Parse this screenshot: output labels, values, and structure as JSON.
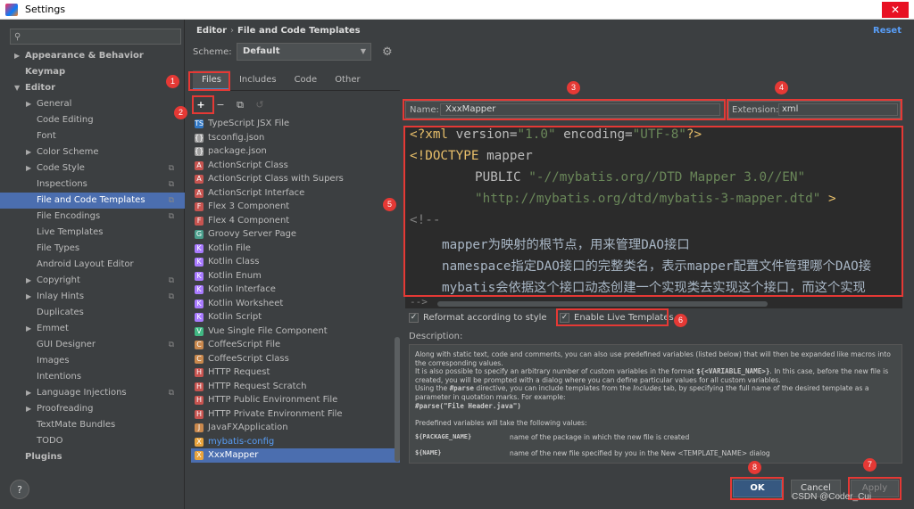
{
  "window": {
    "title": "Settings",
    "close_symbol": "✕"
  },
  "sidebar": {
    "search_placeholder": "",
    "items": [
      {
        "label": "Appearance & Behavior",
        "level": 0,
        "arrow": "▶",
        "bold": true
      },
      {
        "label": "Keymap",
        "level": 0,
        "arrow": "",
        "bold": true
      },
      {
        "label": "Editor",
        "level": 0,
        "arrow": "▼",
        "bold": true
      },
      {
        "label": "General",
        "level": 1,
        "arrow": "▶"
      },
      {
        "label": "Code Editing",
        "level": 1,
        "arrow": ""
      },
      {
        "label": "Font",
        "level": 1,
        "arrow": ""
      },
      {
        "label": "Color Scheme",
        "level": 1,
        "arrow": "▶"
      },
      {
        "label": "Code Style",
        "level": 1,
        "arrow": "▶",
        "copy": true
      },
      {
        "label": "Inspections",
        "level": 1,
        "arrow": "",
        "copy": true
      },
      {
        "label": "File and Code Templates",
        "level": 1,
        "arrow": "",
        "copy": true,
        "selected": true
      },
      {
        "label": "File Encodings",
        "level": 1,
        "arrow": "",
        "copy": true
      },
      {
        "label": "Live Templates",
        "level": 1,
        "arrow": ""
      },
      {
        "label": "File Types",
        "level": 1,
        "arrow": ""
      },
      {
        "label": "Android Layout Editor",
        "level": 1,
        "arrow": ""
      },
      {
        "label": "Copyright",
        "level": 1,
        "arrow": "▶",
        "copy": true
      },
      {
        "label": "Inlay Hints",
        "level": 1,
        "arrow": "▶",
        "copy": true
      },
      {
        "label": "Duplicates",
        "level": 1,
        "arrow": ""
      },
      {
        "label": "Emmet",
        "level": 1,
        "arrow": "▶"
      },
      {
        "label": "GUI Designer",
        "level": 1,
        "arrow": "",
        "copy": true
      },
      {
        "label": "Images",
        "level": 1,
        "arrow": ""
      },
      {
        "label": "Intentions",
        "level": 1,
        "arrow": ""
      },
      {
        "label": "Language Injections",
        "level": 1,
        "arrow": "▶",
        "copy": true
      },
      {
        "label": "Proofreading",
        "level": 1,
        "arrow": "▶"
      },
      {
        "label": "TextMate Bundles",
        "level": 1,
        "arrow": ""
      },
      {
        "label": "TODO",
        "level": 1,
        "arrow": ""
      },
      {
        "label": "Plugins",
        "level": 0,
        "arrow": "",
        "bold": true
      }
    ]
  },
  "header": {
    "crumb_1": "Editor",
    "crumb_sep": "›",
    "crumb_2": "File and Code Templates",
    "reset": "Reset",
    "scheme_label": "Scheme:",
    "scheme_value": "Default"
  },
  "tabs": [
    "Files",
    "Includes",
    "Code",
    "Other"
  ],
  "toolbar": {
    "add": "+",
    "remove": "−",
    "copy": "⧉",
    "reset": "↺"
  },
  "files": [
    {
      "name": "TypeScript JSX File",
      "icon": "TS",
      "color": "#3178c6"
    },
    {
      "name": "tsconfig.json",
      "icon": "{}",
      "color": "#a0a0a0"
    },
    {
      "name": "package.json",
      "icon": "{}",
      "color": "#a0a0a0"
    },
    {
      "name": "ActionScript Class",
      "icon": "A",
      "color": "#c75450"
    },
    {
      "name": "ActionScript Class with Supers",
      "icon": "A",
      "color": "#c75450"
    },
    {
      "name": "ActionScript Interface",
      "icon": "A",
      "color": "#c75450"
    },
    {
      "name": "Flex 3 Component",
      "icon": "F",
      "color": "#c75450"
    },
    {
      "name": "Flex 4 Component",
      "icon": "F",
      "color": "#c75450"
    },
    {
      "name": "Groovy Server Page",
      "icon": "G",
      "color": "#4a9e8c"
    },
    {
      "name": "Kotlin File",
      "icon": "K",
      "color": "#a97bff"
    },
    {
      "name": "Kotlin Class",
      "icon": "K",
      "color": "#a97bff"
    },
    {
      "name": "Kotlin Enum",
      "icon": "K",
      "color": "#a97bff"
    },
    {
      "name": "Kotlin Interface",
      "icon": "K",
      "color": "#a97bff"
    },
    {
      "name": "Kotlin Worksheet",
      "icon": "K",
      "color": "#a97bff"
    },
    {
      "name": "Kotlin Script",
      "icon": "K",
      "color": "#a97bff"
    },
    {
      "name": "Vue Single File Component",
      "icon": "V",
      "color": "#41b883"
    },
    {
      "name": "CoffeeScript File",
      "icon": "C",
      "color": "#c9884c"
    },
    {
      "name": "CoffeeScript Class",
      "icon": "C",
      "color": "#c9884c"
    },
    {
      "name": "HTTP Request",
      "icon": "H",
      "color": "#c75450"
    },
    {
      "name": "HTTP Request Scratch",
      "icon": "H",
      "color": "#c75450"
    },
    {
      "name": "HTTP Public Environment File",
      "icon": "H",
      "color": "#c75450"
    },
    {
      "name": "HTTP Private Environment File",
      "icon": "H",
      "color": "#c75450"
    },
    {
      "name": "JavaFXApplication",
      "icon": "J",
      "color": "#c9884c"
    },
    {
      "name": "mybatis-config",
      "icon": "X",
      "color": "#e8a33d",
      "blue": true
    },
    {
      "name": "XxxMapper",
      "icon": "X",
      "color": "#e8a33d",
      "selected": true
    }
  ],
  "name_field": {
    "label": "Name:",
    "value": "XxxMapper"
  },
  "extension_field": {
    "label": "Extension:",
    "value": "xml"
  },
  "editor": {
    "line1_open": "<?xml ",
    "line1_attr1": "version",
    "line1_eq1": "=",
    "line1_val1": "\"1.0\"",
    "line1_attr2": " encoding",
    "line1_eq2": "=",
    "line1_val2": "\"UTF-8\"",
    "line1_close": "?>",
    "line2_open": "<!DOCTYPE ",
    "line2_rest": "mapper",
    "line3_kw": "PUBLIC ",
    "line3_str": "\"-//mybatis.org//DTD Mapper 3.0//EN\"",
    "line4_str": "\"http://mybatis.org/dtd/mybatis-3-mapper.dtd\"",
    "line4_close": " >",
    "line5": "<!--",
    "line6": "mapper为映射的根节点，用来管理DAO接口",
    "line7": "namespace指定DAO接口的完整类名，表示mapper配置文件管理哪个DAO接",
    "line8": "mybatis会依据这个接口动态创建一个实现类去实现这个接口，而这个实现",
    "line9": "-->"
  },
  "options": {
    "reformat": "Reformat according to style",
    "live_templates": "Enable Live Templates",
    "check": "✓"
  },
  "description": {
    "label": "Description:",
    "p1": "Along with static text, code and comments, you can also use predefined variables (listed below) that will then be expanded like macros into the corresponding values.",
    "p2a": "It is also possible to specify an arbitrary number of custom variables in the format ",
    "p2code": "${<VARIABLE_NAME>}",
    "p2b": ". In this case, before the new file is created, you will be prompted with a dialog where you can define particular values for all custom variables.",
    "p3a": "Using the ",
    "p3code": "#parse",
    "p3b": " directive, you can include templates from the ",
    "p3it": "Includes",
    "p3c": " tab, by specifying the full name of the desired template as a parameter in quotation marks. For example:",
    "p4code": "#parse(\"File Header.java\")",
    "p5": "Predefined variables will take the following values:",
    "vars": [
      {
        "name": "${PACKAGE_NAME}",
        "desc": "name of the package in which the new file is created"
      },
      {
        "name": "${NAME}",
        "desc": "name of the new file specified by you in the New <TEMPLATE_NAME> dialog"
      }
    ]
  },
  "buttons": {
    "ok": "OK",
    "cancel": "Cancel",
    "apply": "Apply",
    "help": "?"
  },
  "annotations": [
    "1",
    "2",
    "3",
    "4",
    "5",
    "6",
    "7",
    "8"
  ],
  "watermark": "CSDN @Coder_Cui",
  "colors": {
    "accent": "#4b6eaf",
    "highlight": "#e53935",
    "link": "#589df6"
  }
}
